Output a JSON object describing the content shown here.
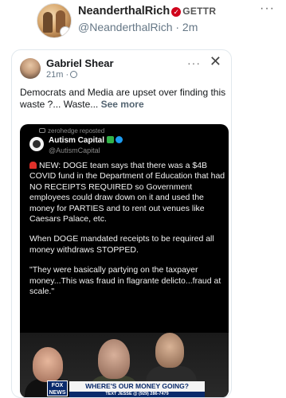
{
  "outer_post": {
    "author_name": "NeanderthalRich",
    "platform_badge": "GETTR",
    "handle_time": "@NeanderthalRich · 2m",
    "more_label": "···"
  },
  "quoted_post": {
    "author_name": "Gabriel Shear",
    "time": "21m ·",
    "more_label": "···",
    "close_label": "✕",
    "text": "Democrats and Media are upset over finding this waste ?... Waste...",
    "see_more": "See more"
  },
  "embedded_image": {
    "reposted_by": "zerohedge reposted",
    "account_name": "Autism Capital",
    "account_handle": "@AutismCapital",
    "paragraphs": [
      "NEW: DOGE team says that there was a $4B COVID fund in the Department of Education that had NO RECEIPTS REQUIRED so Government employees could draw down on it and used the money for PARTIES and to rent out venues like Caesars Palace, etc.",
      "When DOGE mandated receipts to be required all money withdraws STOPPED.",
      "\"They were basically partying on the taxpayer money...This was fraud in flagrante delicto...fraud at scale.\""
    ],
    "news_logo": "FOX NEWS",
    "chyron": "WHERE'S OUR MONEY GOING?",
    "ticker": "TEXT JESSE @ (929) 286-7479"
  },
  "colors": {
    "verified_red": "#d0021b",
    "link_gray": "#536471",
    "checkmark_blue": "#1d9bf0"
  }
}
